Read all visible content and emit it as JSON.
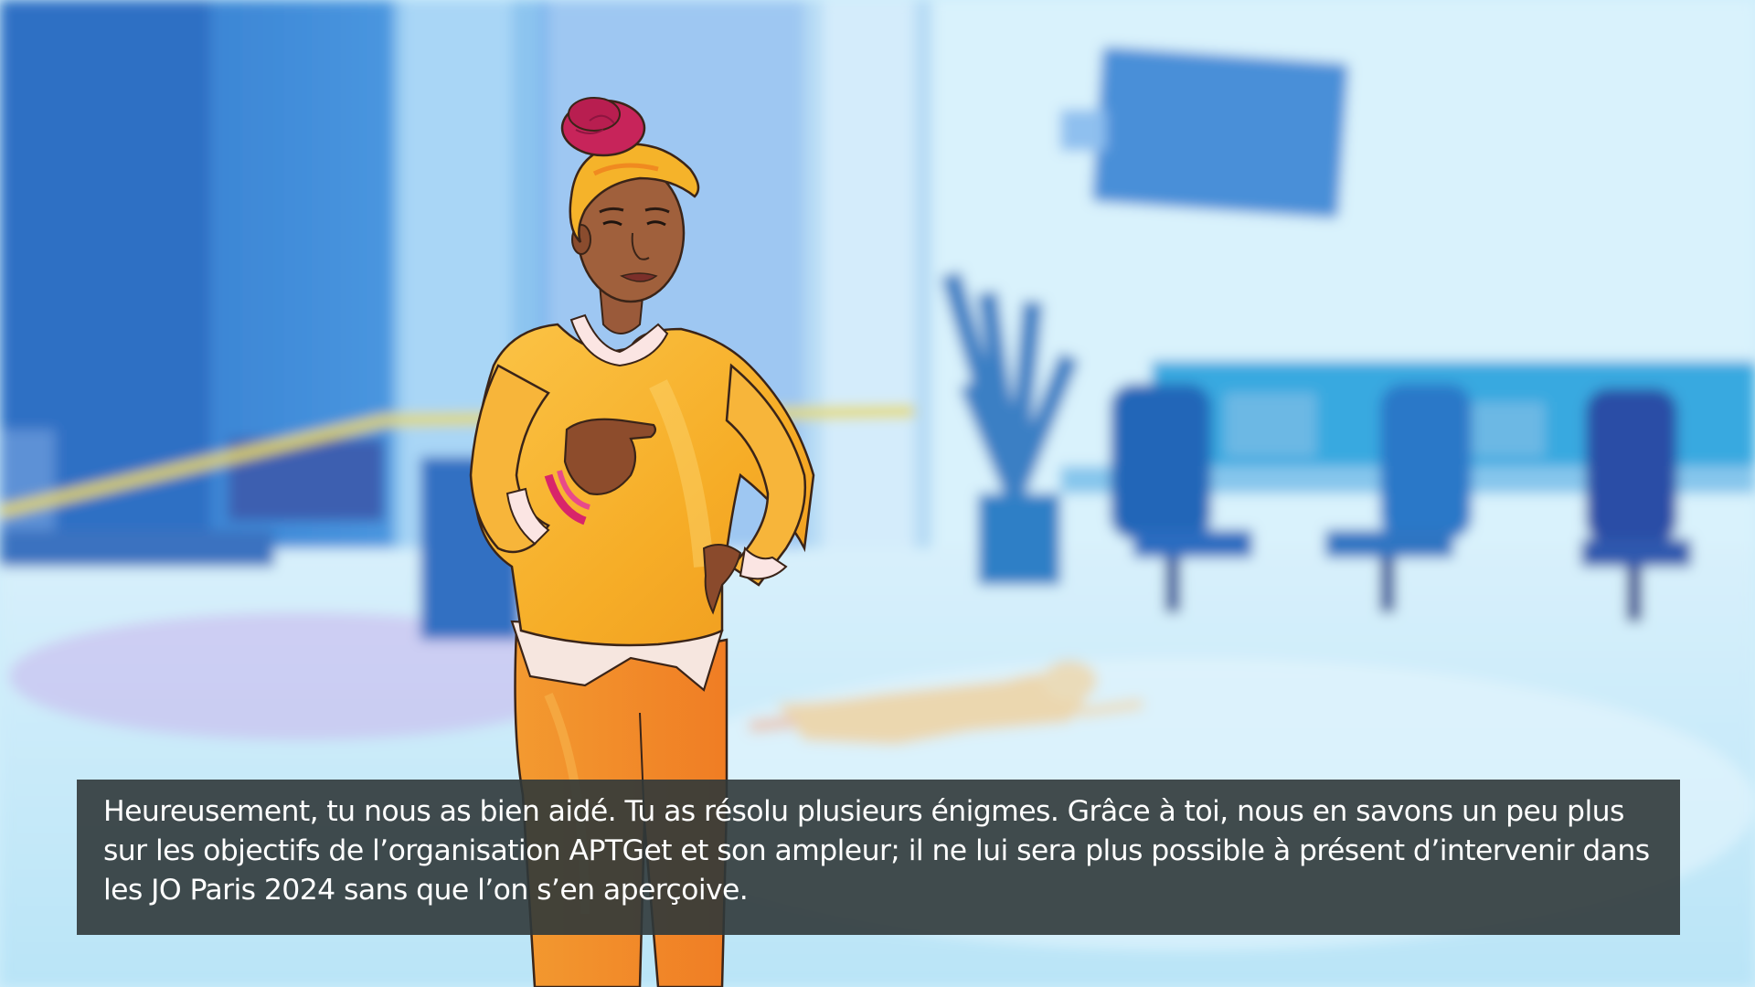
{
  "scene": {
    "type": "visual-novel-dialogue",
    "background": "blurred-watercolor-office-crime-scene",
    "character": "detective-woman-yellow-sweater",
    "colors": {
      "wall_blue": "#3b86d6",
      "sky_light": "#d4f1fb",
      "sweater": "#f7b52b",
      "pants": "#f4912a",
      "hair_wrap": "#c8265a",
      "dialogue_bg": "#30383a"
    }
  },
  "dialogue": {
    "text": "Heureusement, tu nous as bien aidé. Tu as résolu plusieurs énigmes. Grâce à toi, nous en savons un peu plus sur les objectifs de l’organisation APTGet et son ampleur; il ne lui sera plus possible à présent d’intervenir dans les JO Paris 2024 sans que l’on s’en aperçoive."
  }
}
